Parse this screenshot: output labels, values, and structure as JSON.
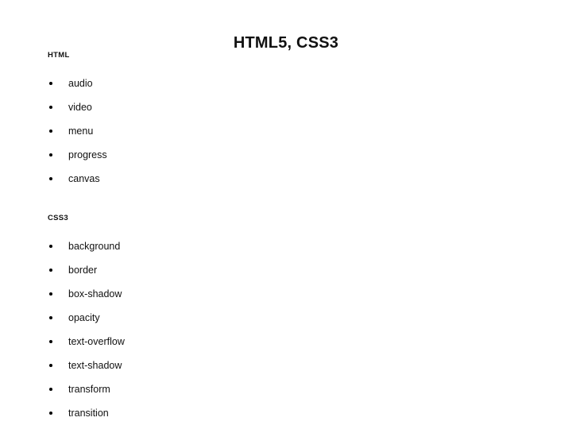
{
  "slide": {
    "title": "HTML5, CSS3",
    "background_color": "#ffffff",
    "text_color": "#111111",
    "bullet_color": "#000000",
    "sections": [
      {
        "heading": "HTML",
        "items": [
          {
            "label": "audio"
          },
          {
            "label": "video"
          },
          {
            "label": "menu"
          },
          {
            "label": "progress"
          },
          {
            "label": "canvas"
          }
        ]
      },
      {
        "heading": "CSS3",
        "items": [
          {
            "label": "background"
          },
          {
            "label": "border"
          },
          {
            "label": "box-shadow"
          },
          {
            "label": "opacity"
          },
          {
            "label": "text-overflow"
          },
          {
            "label": "text-shadow"
          },
          {
            "label": "transform"
          },
          {
            "label": "transition"
          }
        ]
      }
    ]
  }
}
